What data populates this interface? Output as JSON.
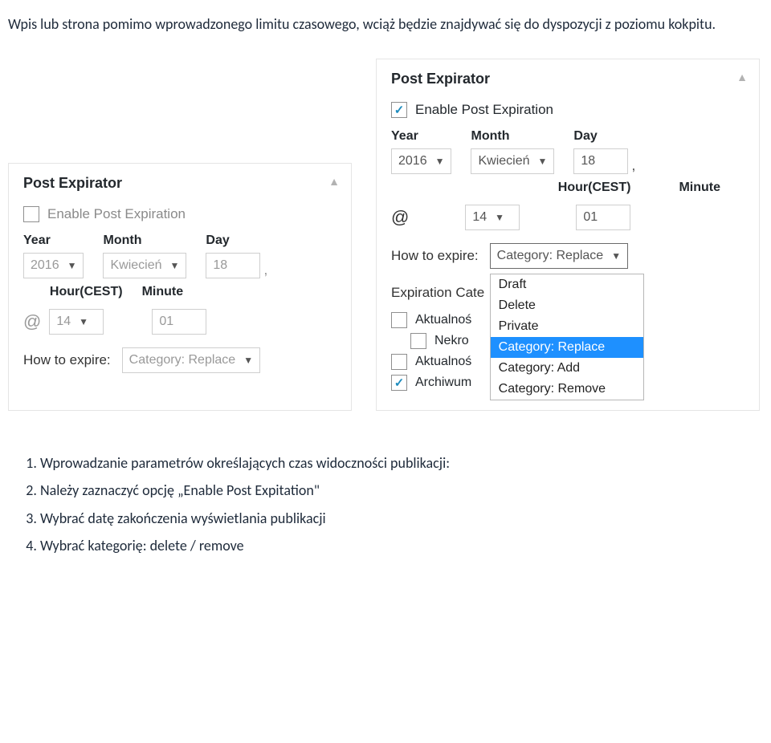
{
  "intro": "Wpis lub strona pomimo wprowadzonego limitu czasowego, wciąż będzie znajdywać się do dyspozycji z poziomu kokpitu.",
  "panel_title": "Post Expirator",
  "enable_label": "Enable Post Expiration",
  "labels": {
    "year": "Year",
    "month": "Month",
    "day": "Day",
    "hour": "Hour(CEST)",
    "minute": "Minute",
    "how": "How to expire:",
    "exp_cat": "Expiration Cate"
  },
  "values": {
    "year": "2016",
    "month": "Kwiecień",
    "day": "18",
    "hour": "14",
    "minute": "01",
    "how": "Category: Replace"
  },
  "dropdown": [
    "Draft",
    "Delete",
    "Private",
    "Category: Replace",
    "Category: Add",
    "Category: Remove"
  ],
  "dropdown_selected": "Category: Replace",
  "cats": [
    "Aktualnoś",
    "Nekro",
    "Aktualnoś",
    "Archiwum"
  ],
  "cats_checked": [
    false,
    false,
    false,
    true
  ],
  "steps": [
    "Wprowadzanie parametrów określających czas widoczności publikacji:",
    "Należy zaznaczyć opcję „Enable Post Expitation\"",
    "Wybrać datę zakończenia wyświetlania publikacji",
    "Wybrać kategorię: delete / remove"
  ]
}
